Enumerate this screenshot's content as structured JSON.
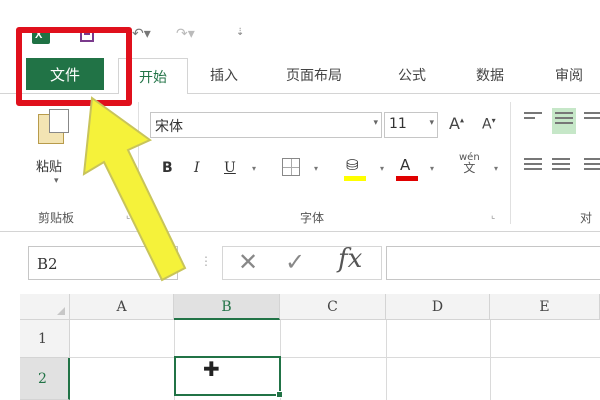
{
  "quick_access": {
    "app_icon": "excel-logo-icon",
    "app_icon_letter": "X",
    "save_icon": "save-icon",
    "undo_icon": "undo-icon",
    "redo_icon": "redo-icon",
    "customize_icon": "customize-dropdown-icon"
  },
  "tabs": {
    "file": "文件",
    "home": "开始",
    "insert": "插入",
    "page_layout": "页面布局",
    "formulas": "公式",
    "data": "数据",
    "review": "审阅"
  },
  "ribbon": {
    "clipboard": {
      "paste_label": "粘贴",
      "group_label": "剪贴板"
    },
    "font": {
      "font_name": "宋体",
      "font_size": "11",
      "grow_label": "A",
      "shrink_label": "A",
      "bold": "B",
      "italic": "I",
      "underline": "U",
      "font_color_label": "A",
      "phonetic_top": "wén",
      "phonetic_bottom": "文",
      "group_label": "字体",
      "fill_color": "#ffff00",
      "font_color": "#e00000"
    },
    "alignment": {
      "group_label": "对"
    }
  },
  "formula_bar": {
    "name_box_value": "B2",
    "fx_label": "fx",
    "formula_value": ""
  },
  "grid": {
    "columns": [
      "A",
      "B",
      "C",
      "D",
      "E"
    ],
    "rows": [
      "1",
      "2"
    ],
    "active_cell": "B2"
  },
  "annotation": {
    "highlight_color": "#e0101c",
    "arrow_color": "#f5f23a"
  },
  "colors": {
    "excel_green": "#217346"
  }
}
